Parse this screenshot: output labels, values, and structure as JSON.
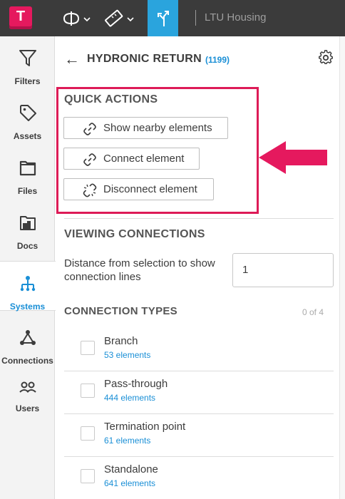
{
  "app": {
    "logo_letter": "T",
    "project_name": "LTU Housing"
  },
  "toolbar": {
    "icons": [
      "section-plane-icon",
      "measure-icon",
      "systems-icon"
    ],
    "active": "systems-icon",
    "accent": "#2aa4dd"
  },
  "sidebar": {
    "items": [
      {
        "label": "Filters",
        "icon": "filter-icon"
      },
      {
        "label": "Assets",
        "icon": "tag-icon"
      },
      {
        "label": "Files",
        "icon": "folder-icon"
      },
      {
        "label": "Docs",
        "icon": "building-folder-icon"
      },
      {
        "label": "Systems",
        "icon": "systems-tree-icon",
        "active": true
      },
      {
        "label": "Connections",
        "icon": "connections-icon"
      },
      {
        "label": "Users",
        "icon": "users-icon"
      }
    ]
  },
  "header": {
    "back_glyph": "←",
    "title": "HYDRONIC RETURN",
    "count": "(1199)"
  },
  "quick_actions": {
    "title": "QUICK ACTIONS",
    "buttons": [
      {
        "label": "Show nearby elements",
        "icon": "link-icon"
      },
      {
        "label": "Connect element",
        "icon": "link-icon"
      },
      {
        "label": "Disconnect element",
        "icon": "unlink-icon"
      }
    ],
    "highlight_color": "#dd1b57"
  },
  "viewing": {
    "title": "VIEWING CONNECTIONS",
    "distance_label": "Distance from selection to show connection lines",
    "distance_value": "1"
  },
  "connection_types": {
    "title": "CONNECTION TYPES",
    "count": "0 of 4",
    "items": [
      {
        "name": "Branch",
        "count": "53 elements"
      },
      {
        "name": "Pass-through",
        "count": "444 elements"
      },
      {
        "name": "Termination point",
        "count": "61 elements"
      },
      {
        "name": "Standalone",
        "count": "641 elements"
      }
    ]
  },
  "colors": {
    "brand": "#e5195e",
    "link": "#1a8fd6",
    "topbar": "#3b3b3b"
  }
}
